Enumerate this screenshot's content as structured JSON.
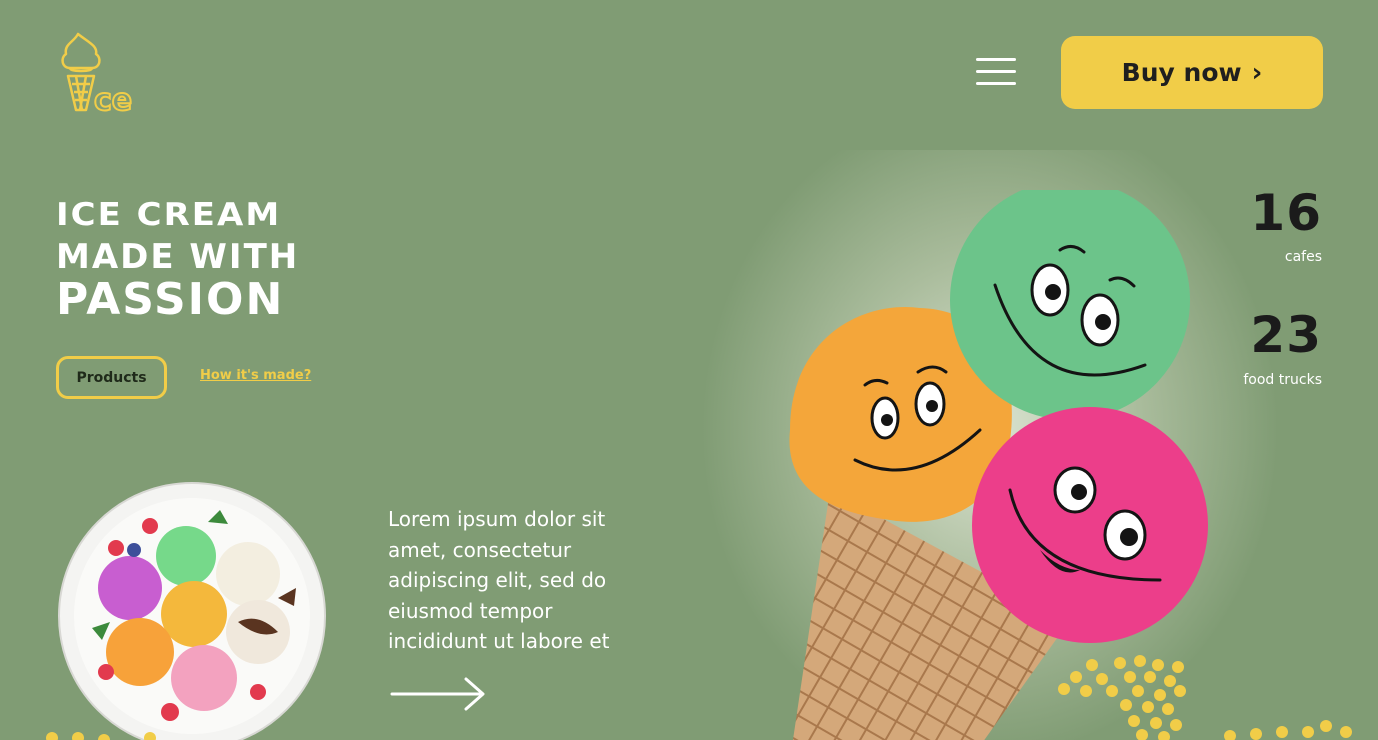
{
  "brand": {
    "logo_text": "ce",
    "logo_icon": "ice-cream-cone-icon"
  },
  "header": {
    "menu_icon": "hamburger-menu-icon",
    "buy_label": "Buy now",
    "buy_chevron": "›"
  },
  "hero": {
    "line1": "ICE CREAM",
    "line2": "MADE WITH",
    "line3": "PASSION",
    "products_label": "Products",
    "how_link": "How it's made?",
    "description": "Lorem ipsum dolor sit amet, consectetur adipiscing elit, sed do eiusmod tempor incididunt ut labore et",
    "arrow_icon": "arrow-right-icon"
  },
  "stats": [
    {
      "value": "16",
      "label": "cafes"
    },
    {
      "value": "23",
      "label": "food trucks"
    }
  ],
  "colors": {
    "background": "#809c74",
    "accent": "#f1cd48",
    "dark": "#1b1b1b"
  }
}
